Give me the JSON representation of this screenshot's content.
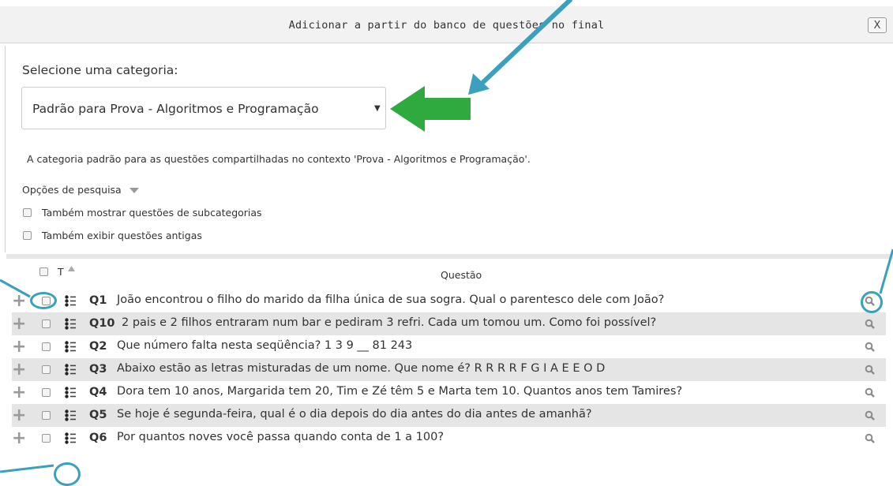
{
  "dialog": {
    "title": "Adicionar a partir do banco de questões no final",
    "close_label": "X"
  },
  "category": {
    "label": "Selecione uma categoria:",
    "selected": "Padrão para Prova - Algoritmos e Programação",
    "description": "A categoria padrão para as questões compartilhadas no contexto 'Prova - Algoritmos e Programação'."
  },
  "search_options": {
    "label": "Opções de pesquisa",
    "options": [
      "Também mostrar questões de subcategorias",
      "Também exibir questões antigas"
    ]
  },
  "table": {
    "col_type": "T",
    "col_question": "Questão",
    "rows": [
      {
        "num": "Q1",
        "text": "João encontrou o filho do marido da filha única de sua sogra. Qual o parentesco dele com João?"
      },
      {
        "num": "Q10",
        "text": "2 pais e 2 filhos entraram num bar e pediram 3 refri. Cada um tomou um. Como foi possível?"
      },
      {
        "num": "Q2",
        "text": "Que número falta nesta seqüência? 1 3 9 __ 81 243"
      },
      {
        "num": "Q3",
        "text": "Abaixo estão as letras misturadas de um nome. Que nome é? R R R R F G I A E E O D"
      },
      {
        "num": "Q4",
        "text": "Dora tem 10 anos, Margarida tem 20, Tim e Zé têm 5 e Marta tem 10. Quantos anos tem Tamires?"
      },
      {
        "num": "Q5",
        "text": "Se hoje é segunda-feira, qual é o dia depois do dia antes do dia antes de amanhã?"
      },
      {
        "num": "Q6",
        "text": "Por quantos noves você passa quando conta de 1 a 100?"
      }
    ]
  },
  "colors": {
    "callout_blue": "#3aa0bd",
    "green_arrow": "#2eaa3f"
  },
  "icons": {
    "add": "plus-icon",
    "type": "multichoice-list-icon",
    "preview": "magnifier-icon",
    "sort": "sort-up-icon",
    "expand": "triangle-down-icon"
  }
}
